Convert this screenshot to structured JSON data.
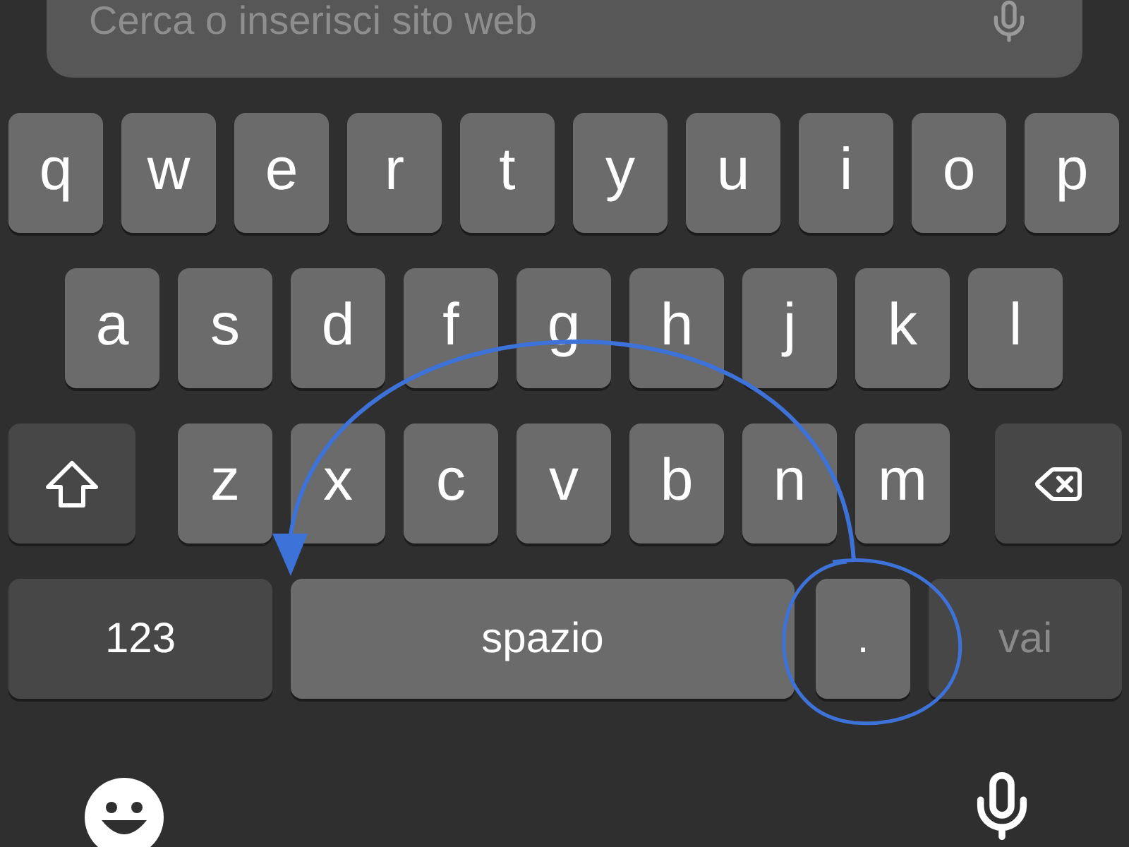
{
  "search": {
    "placeholder": "Cerca o inserisci sito web"
  },
  "keyboard": {
    "key_rows": [
      {
        "keys": [
          {
            "kind": "letter",
            "label": "q"
          },
          {
            "kind": "letter",
            "label": "w"
          },
          {
            "kind": "letter",
            "label": "e"
          },
          {
            "kind": "letter",
            "label": "r"
          },
          {
            "kind": "letter",
            "label": "t"
          },
          {
            "kind": "letter",
            "label": "y"
          },
          {
            "kind": "letter",
            "label": "u"
          },
          {
            "kind": "letter",
            "label": "i"
          },
          {
            "kind": "letter",
            "label": "o"
          },
          {
            "kind": "letter",
            "label": "p"
          }
        ]
      },
      {
        "keys": [
          {
            "kind": "letter",
            "label": "a"
          },
          {
            "kind": "letter",
            "label": "s"
          },
          {
            "kind": "letter",
            "label": "d"
          },
          {
            "kind": "letter",
            "label": "f"
          },
          {
            "kind": "letter",
            "label": "g"
          },
          {
            "kind": "letter",
            "label": "h"
          },
          {
            "kind": "letter",
            "label": "j"
          },
          {
            "kind": "letter",
            "label": "k"
          },
          {
            "kind": "letter",
            "label": "l"
          }
        ]
      },
      {
        "keys": [
          {
            "kind": "shift"
          },
          {
            "kind": "letter",
            "label": "z"
          },
          {
            "kind": "letter",
            "label": "x"
          },
          {
            "kind": "letter",
            "label": "c"
          },
          {
            "kind": "letter",
            "label": "v"
          },
          {
            "kind": "letter",
            "label": "b"
          },
          {
            "kind": "letter",
            "label": "n"
          },
          {
            "kind": "letter",
            "label": "m"
          },
          {
            "kind": "delete"
          }
        ]
      },
      {
        "keys": [
          {
            "kind": "mode",
            "label": "123"
          },
          {
            "kind": "space",
            "label": "spazio"
          },
          {
            "kind": "period",
            "label": "."
          },
          {
            "kind": "go",
            "label": "vai",
            "disabled": true
          }
        ]
      }
    ]
  }
}
